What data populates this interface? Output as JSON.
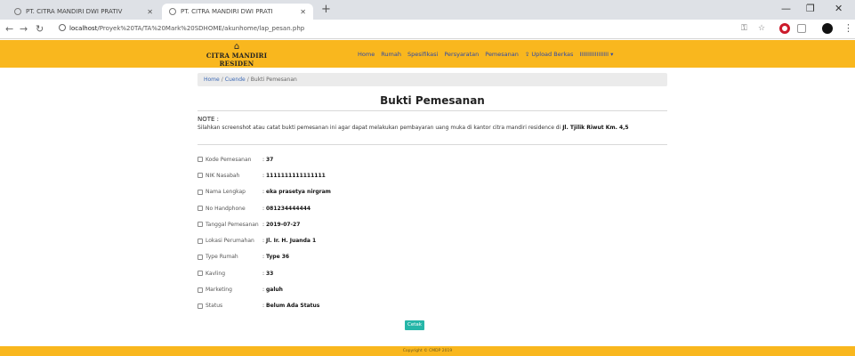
{
  "browser": {
    "tabs": [
      {
        "title": "PT. CITRA MANDIRI DWI PRATIV"
      },
      {
        "title": "PT. CITRA MANDIRI DWI PRATI"
      }
    ],
    "new_tab": "+",
    "url_host": "localhost",
    "url_path": "/Proyek%20TA/TA%20Mark%20SDHOME/akunhome/lap_pesan.php"
  },
  "site": {
    "brand": "CITRA MANDIRI RESIDEN",
    "menu": [
      "Home",
      "Rumah",
      "Spesifikasi",
      "Persyaratan",
      "Pemesanan",
      "Upload Berkas",
      "IIIIIIIIIIIIIIIII"
    ]
  },
  "breadcrumb": {
    "home": "Home",
    "middle": "Cuende",
    "current": "Bukti Pemesanan"
  },
  "title": "Bukti Pemesanan",
  "note": {
    "title": "NOTE :",
    "text": "Silahkan screenshot atau catat bukti pemesanan ini agar dapat melakukan pembayaran uang muka di kantor citra mandiri residence di ",
    "address": "Jl. Tjilik Riwut Km. 4,5"
  },
  "details": [
    {
      "label": "Kode Pemesanan",
      "value": "37"
    },
    {
      "label": "NIK Nasabah",
      "value": "1111111111111111"
    },
    {
      "label": "Nama Lengkap",
      "value": "eka prasetya nirgram"
    },
    {
      "label": "No Handphone",
      "value": "081234444444"
    },
    {
      "label": "Tanggal Pemesanan",
      "value": "2019-07-27"
    },
    {
      "label": "Lokasi Perumahan",
      "value": "Jl. Ir. H. Juanda 1"
    },
    {
      "label": "Type Rumah",
      "value": "Type 36"
    },
    {
      "label": "Kavling",
      "value": "33"
    },
    {
      "label": "Marketing",
      "value": "galuh"
    },
    {
      "label": "Status",
      "value": "Belum Ada Status"
    }
  ],
  "print_label": "Cetak",
  "footer": "Copyright © CMDP 2019",
  "colors": {
    "accent": "#f9b71e",
    "button": "#26b6a8",
    "link": "#3c69b5"
  }
}
